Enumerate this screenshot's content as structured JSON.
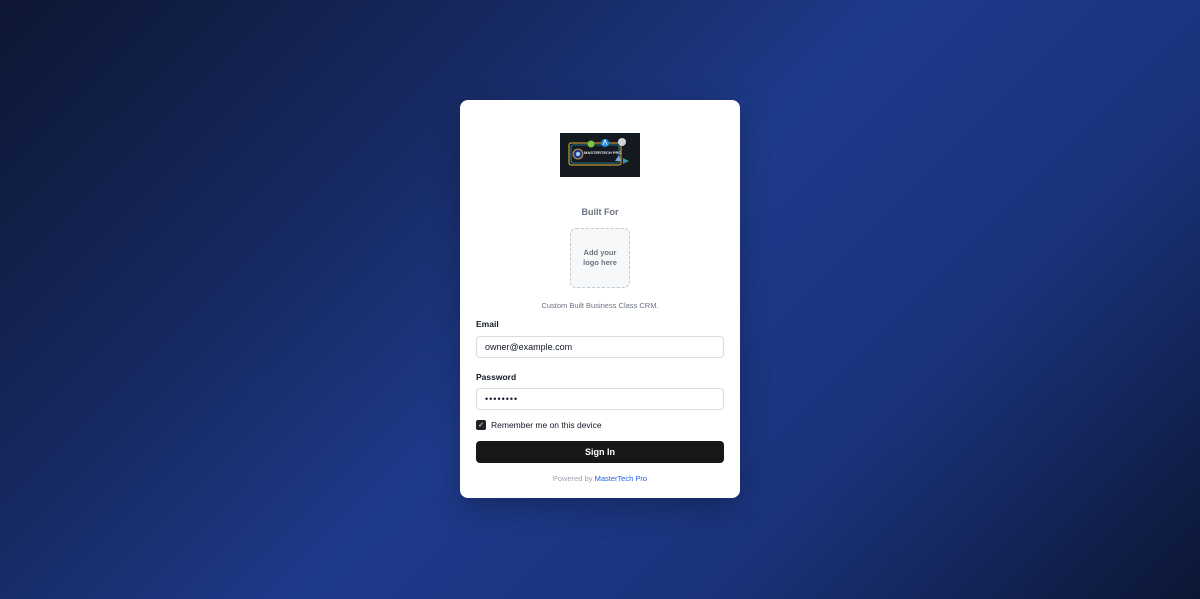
{
  "brand": {
    "logo_icon": "mastertech-pro-apps-logo",
    "logo_text": "MASTERTECH PRO"
  },
  "built_for": "Built For",
  "placeholder_logo": "Add your logo here",
  "tagline": "Custom Built Business Class CRM.",
  "form": {
    "email_label": "Email",
    "email_value": "owner@example.com",
    "password_label": "Password",
    "password_value": "••••••••",
    "remember_label": "Remember me on this device",
    "remember_checked": true,
    "submit_label": "Sign In"
  },
  "footer": {
    "powered_prefix": "Powered by",
    "powered_brand": "MasterTech Pro"
  },
  "colors": {
    "brand_link": "#2563eb",
    "button_bg": "#18181b",
    "background_accent": "#1e3a8a"
  }
}
